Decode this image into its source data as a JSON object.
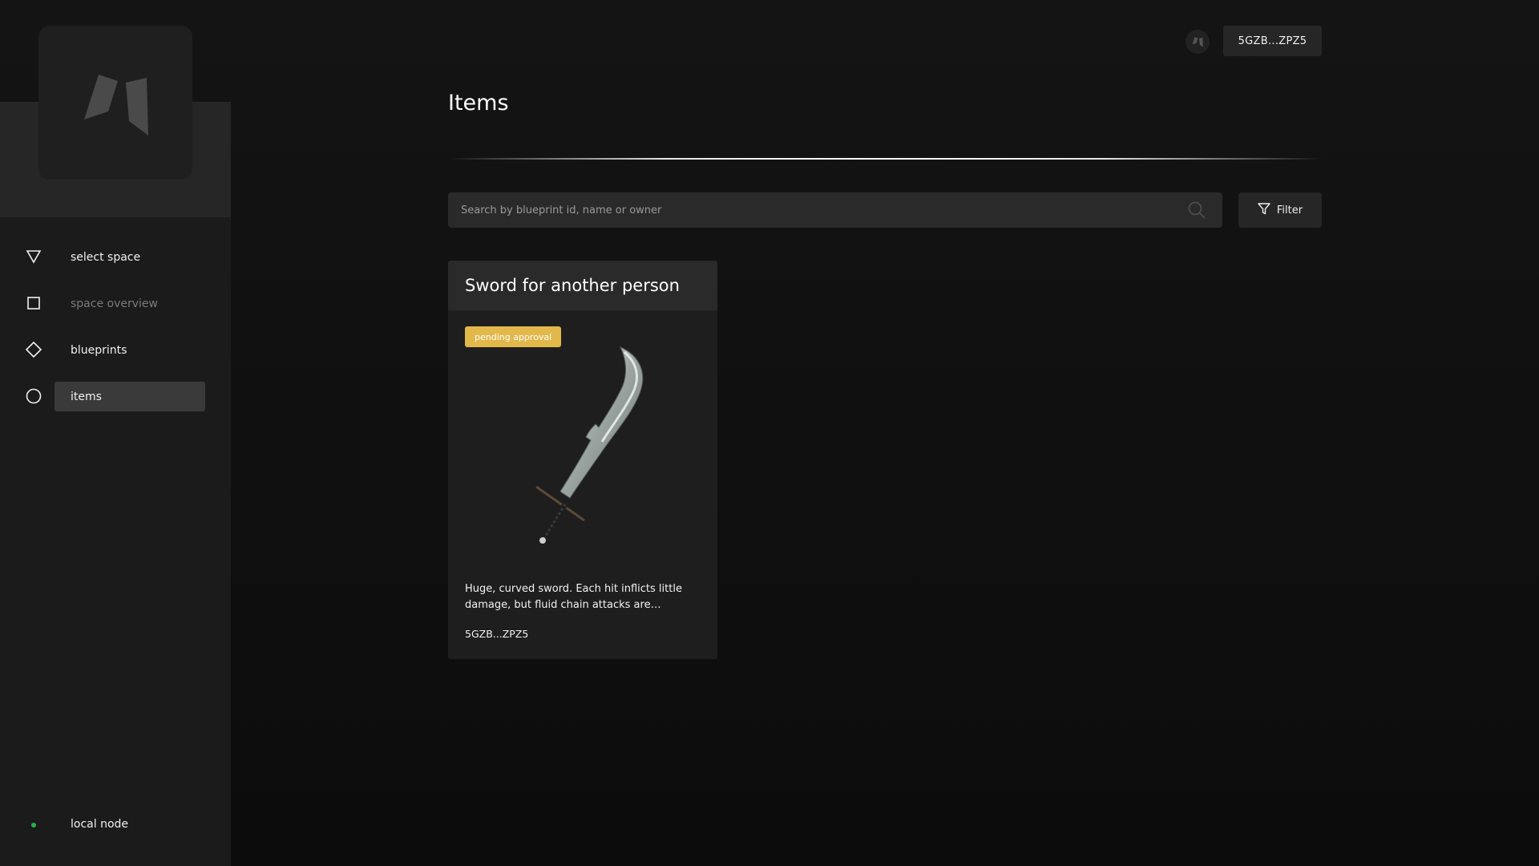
{
  "sidebar": {
    "items": [
      {
        "label": "select space",
        "icon": "triangle-down-icon",
        "state": "normal"
      },
      {
        "label": "space overview",
        "icon": "square-icon",
        "state": "muted"
      },
      {
        "label": "blueprints",
        "icon": "diamond-icon",
        "state": "normal"
      },
      {
        "label": "items",
        "icon": "circle-icon",
        "state": "active"
      }
    ],
    "node_status": {
      "label": "local node",
      "color": "#28b14c"
    }
  },
  "header": {
    "account_label": "5GZB...ZPZ5"
  },
  "main": {
    "title": "Items",
    "search": {
      "placeholder": "Search by blueprint id, name or owner",
      "value": ""
    },
    "filter_label": "Filter"
  },
  "items": [
    {
      "title": "Sword for another person",
      "status": "pending approval",
      "status_color": "#e2b84b",
      "description": "Huge, curved sword. Each hit inflicts little damage, but fluid chain attacks are deadly.\"…",
      "owner": "5GZB...ZPZ5"
    }
  ]
}
